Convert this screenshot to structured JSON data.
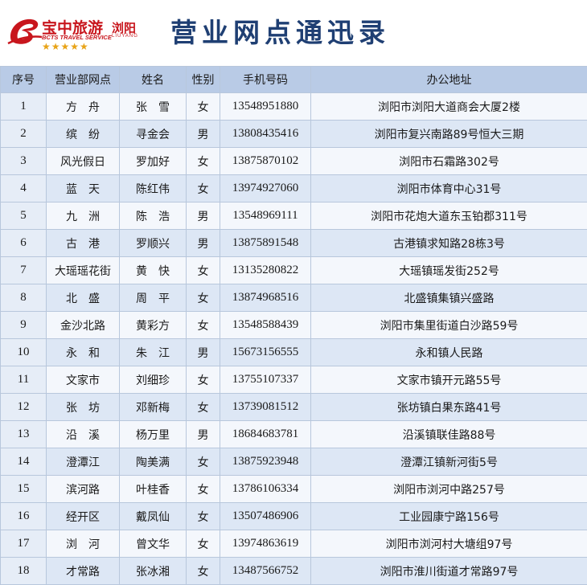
{
  "header": {
    "logo_main": "宝中旅游",
    "logo_sub": "BCTS TRAVEL SERVICE",
    "logo_city": "浏阳",
    "logo_city_en": "LIUYANG",
    "logo_stars": "★★★★★",
    "title": "营业网点通迅录"
  },
  "colors": {
    "title": "#1f3f73",
    "brand_red": "#c8161d",
    "star_gold": "#e8a317",
    "header_row": "#b9cbe6",
    "row_alt": "#dde7f5"
  },
  "table": {
    "columns": [
      "序号",
      "营业部网点",
      "姓名",
      "性别",
      "手机号码",
      "办公地址"
    ],
    "rows": [
      {
        "id": "1",
        "branch": "方　舟",
        "name": "张　雪",
        "gender": "女",
        "phone": "13548951880",
        "address": "浏阳市浏阳大道商会大厦2楼"
      },
      {
        "id": "2",
        "branch": "缤　纷",
        "name": "寻金会",
        "gender": "男",
        "phone": "13808435416",
        "address": "浏阳市复兴南路89号恒大三期"
      },
      {
        "id": "3",
        "branch": "风光假日",
        "name": "罗加好",
        "gender": "女",
        "phone": "13875870102",
        "address": "浏阳市石霜路302号"
      },
      {
        "id": "4",
        "branch": "蓝　天",
        "name": "陈红伟",
        "gender": "女",
        "phone": "13974927060",
        "address": "浏阳市体育中心31号"
      },
      {
        "id": "5",
        "branch": "九　洲",
        "name": "陈　浩",
        "gender": "男",
        "phone": "13548969111",
        "address": "浏阳市花炮大道东玉铂郡311号"
      },
      {
        "id": "6",
        "branch": "古　港",
        "name": "罗顺兴",
        "gender": "男",
        "phone": "13875891548",
        "address": "古港镇求知路28栋3号"
      },
      {
        "id": "7",
        "branch": "大瑶瑶花街",
        "name": "黄　快",
        "gender": "女",
        "phone": "13135280822",
        "address": "大瑶镇瑶发街252号"
      },
      {
        "id": "8",
        "branch": "北　盛",
        "name": "周　平",
        "gender": "女",
        "phone": "13874968516",
        "address": "北盛镇集镇兴盛路"
      },
      {
        "id": "9",
        "branch": "金沙北路",
        "name": "黄彩方",
        "gender": "女",
        "phone": "13548588439",
        "address": "浏阳市集里街道白沙路59号"
      },
      {
        "id": "10",
        "branch": "永　和",
        "name": "朱　江",
        "gender": "男",
        "phone": "15673156555",
        "address": "永和镇人民路"
      },
      {
        "id": "11",
        "branch": "文家市",
        "name": "刘细珍",
        "gender": "女",
        "phone": "13755107337",
        "address": "文家市镇开元路55号"
      },
      {
        "id": "12",
        "branch": "张　坊",
        "name": "邓新梅",
        "gender": "女",
        "phone": "13739081512",
        "address": "张坊镇白果东路41号"
      },
      {
        "id": "13",
        "branch": "沿　溪",
        "name": "杨万里",
        "gender": "男",
        "phone": "18684683781",
        "address": "沿溪镇联佳路88号"
      },
      {
        "id": "14",
        "branch": "澄潭江",
        "name": "陶美满",
        "gender": "女",
        "phone": "13875923948",
        "address": "澄潭江镇新河街5号"
      },
      {
        "id": "15",
        "branch": "滨河路",
        "name": "叶桂香",
        "gender": "女",
        "phone": "13786106334",
        "address": "浏阳市浏河中路257号"
      },
      {
        "id": "16",
        "branch": "经开区",
        "name": "戴凤仙",
        "gender": "女",
        "phone": "13507486906",
        "address": "工业园康宁路156号"
      },
      {
        "id": "17",
        "branch": "浏　河",
        "name": "曾文华",
        "gender": "女",
        "phone": "13974863619",
        "address": "浏阳市浏河村大塘组97号"
      },
      {
        "id": "18",
        "branch": "才常路",
        "name": "张冰湘",
        "gender": "女",
        "phone": "13487566752",
        "address": "浏阳市淮川街道才常路97号"
      }
    ]
  }
}
